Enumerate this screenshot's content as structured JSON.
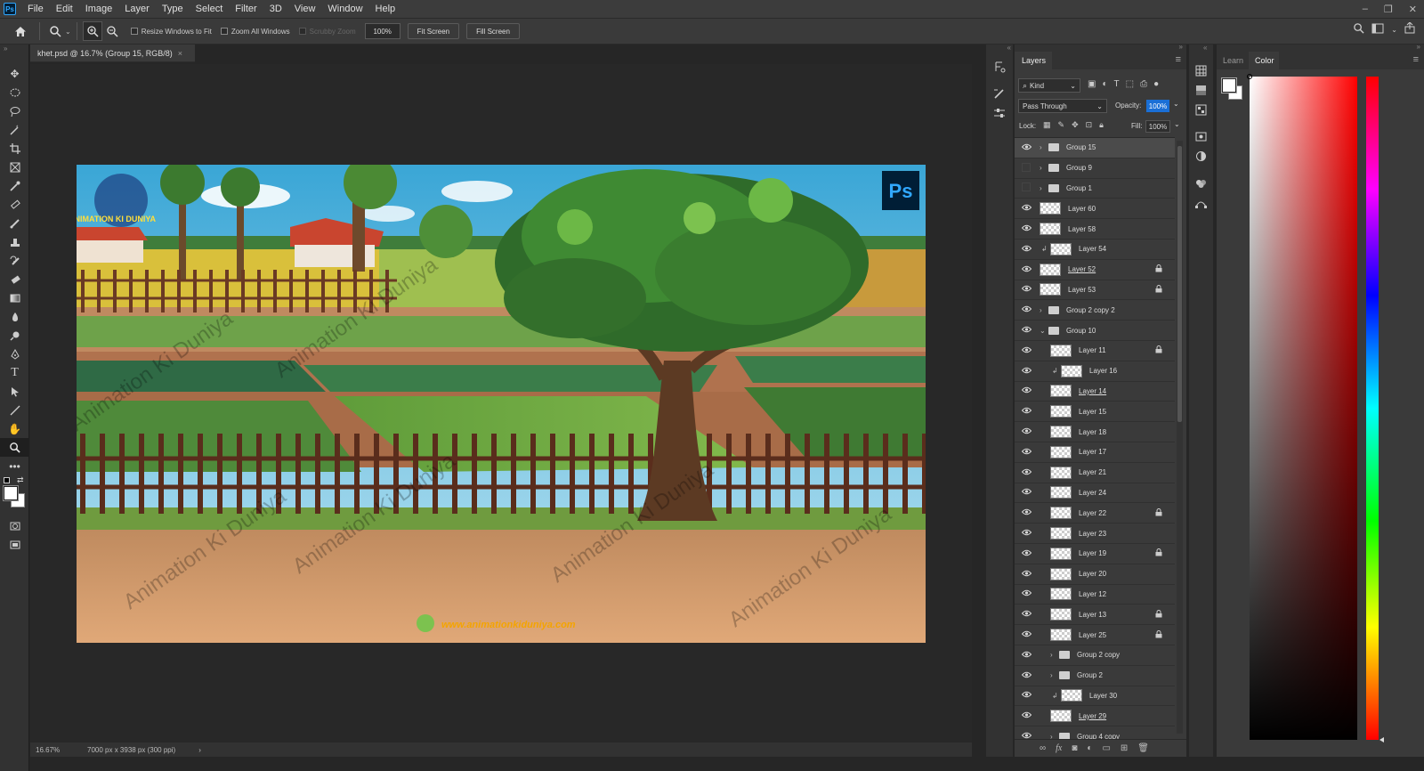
{
  "app": {
    "logo": "Ps"
  },
  "menu": [
    "File",
    "Edit",
    "Image",
    "Layer",
    "Type",
    "Select",
    "Filter",
    "3D",
    "View",
    "Window",
    "Help"
  ],
  "window_controls": {
    "minimize": "–",
    "restore": "❐",
    "close": "✕"
  },
  "options": {
    "resize_windows": "Resize Windows to Fit",
    "zoom_all": "Zoom All Windows",
    "scrubby_zoom": "Scrubby Zoom",
    "zoom_value": "100%",
    "fit_screen": "Fit Screen",
    "fill_screen": "Fill Screen"
  },
  "document": {
    "tab_title": "khet.psd @ 16.7% (Group 15, RGB/8)",
    "tab_close": "×",
    "ps_badge": "Ps",
    "watermark": "Animation Ki Duniya",
    "logo_text": "ANIMATION KI DUNIYA",
    "website": "www.animationkiduniya.com"
  },
  "status": {
    "zoom": "16.67%",
    "size": "7000 px x 3938 px (300 ppi)",
    "arrow": "›"
  },
  "layers_panel": {
    "tab": "Layers",
    "filter_kind": "Kind",
    "blend_mode": "Pass Through",
    "opacity_label": "Opacity:",
    "opacity_value": "100%",
    "lock_label": "Lock:",
    "fill_label": "Fill:",
    "fill_value": "100%",
    "layers": [
      {
        "name": "Group 15",
        "type": "group",
        "visible": true,
        "selected": true
      },
      {
        "name": "Group 9",
        "type": "group",
        "visible": false
      },
      {
        "name": "Group 1",
        "type": "group",
        "visible": false
      },
      {
        "name": "Layer 60",
        "type": "layer",
        "visible": true
      },
      {
        "name": "Layer 58",
        "type": "layer",
        "visible": true
      },
      {
        "name": "Layer 54",
        "type": "layer",
        "visible": true,
        "clip": true
      },
      {
        "name": "Layer 52",
        "type": "layer",
        "visible": true,
        "locked": true,
        "underline": true
      },
      {
        "name": "Layer 53",
        "type": "layer",
        "visible": true,
        "locked": true
      },
      {
        "name": "Group 2 copy 2",
        "type": "group",
        "visible": true
      },
      {
        "name": "Group 10",
        "type": "group",
        "visible": true,
        "open": true
      },
      {
        "name": "Layer 11",
        "type": "layer",
        "visible": true,
        "locked": true,
        "indent": 1
      },
      {
        "name": "Layer 16",
        "type": "layer",
        "visible": true,
        "indent": 1,
        "clip": true
      },
      {
        "name": "Layer 14",
        "type": "layer",
        "visible": true,
        "indent": 1,
        "underline": true
      },
      {
        "name": "Layer 15",
        "type": "layer",
        "visible": true,
        "indent": 1
      },
      {
        "name": "Layer 18",
        "type": "layer",
        "visible": true,
        "indent": 1
      },
      {
        "name": "Layer 17",
        "type": "layer",
        "visible": true,
        "indent": 1
      },
      {
        "name": "Layer 21",
        "type": "layer",
        "visible": true,
        "indent": 1
      },
      {
        "name": "Layer 24",
        "type": "layer",
        "visible": true,
        "indent": 1
      },
      {
        "name": "Layer 22",
        "type": "layer",
        "visible": true,
        "locked": true,
        "indent": 1
      },
      {
        "name": "Layer 23",
        "type": "layer",
        "visible": true,
        "indent": 1
      },
      {
        "name": "Layer 19",
        "type": "layer",
        "visible": true,
        "locked": true,
        "indent": 1
      },
      {
        "name": "Layer 20",
        "type": "layer",
        "visible": true,
        "indent": 1
      },
      {
        "name": "Layer 12",
        "type": "layer",
        "visible": true,
        "indent": 1
      },
      {
        "name": "Layer 13",
        "type": "layer",
        "visible": true,
        "locked": true,
        "indent": 1
      },
      {
        "name": "Layer 25",
        "type": "layer",
        "visible": true,
        "locked": true,
        "indent": 1
      },
      {
        "name": "Group 2 copy",
        "type": "group",
        "visible": true,
        "indent": 1
      },
      {
        "name": "Group 2",
        "type": "group",
        "visible": true,
        "indent": 1
      },
      {
        "name": "Layer 30",
        "type": "layer",
        "visible": true,
        "indent": 1,
        "clip": true
      },
      {
        "name": "Layer 29",
        "type": "layer",
        "visible": true,
        "indent": 1,
        "underline": true
      },
      {
        "name": "Group 4 copy",
        "type": "group",
        "visible": true,
        "indent": 1
      }
    ],
    "footer_icons": [
      "link",
      "fx",
      "mask",
      "adjustment",
      "folder",
      "new-layer",
      "trash"
    ]
  },
  "color_panel": {
    "tabs": [
      "Learn",
      "Color"
    ],
    "active_tab": "Color"
  },
  "colors": {
    "foreground": "#ffffff",
    "background": "#ffffff",
    "hue": "#ff0000"
  }
}
